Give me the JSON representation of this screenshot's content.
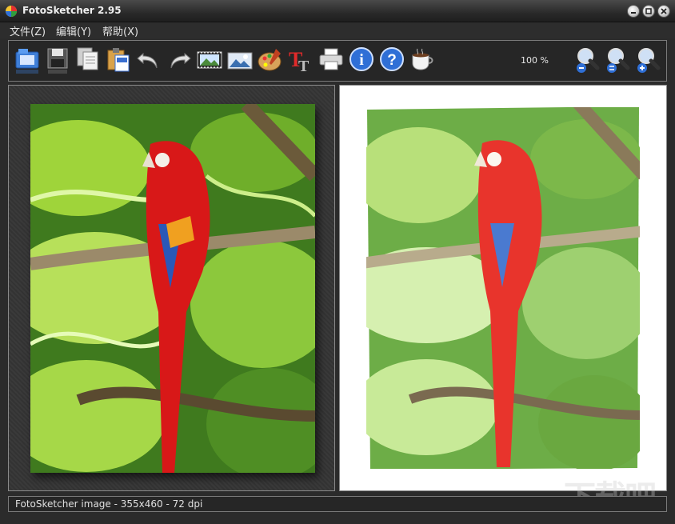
{
  "window": {
    "title": "FotoSketcher 2.95"
  },
  "menu": {
    "file": "文件(Z)",
    "edit": "编辑(Y)",
    "help": "帮助(X)"
  },
  "toolbar": {
    "icons": [
      "open-folder-icon",
      "save-icon",
      "copy-icon",
      "paste-icon",
      "undo-icon",
      "redo-icon",
      "process-image-icon",
      "compare-icon",
      "palette-icon",
      "text-icon",
      "print-icon",
      "info-icon",
      "help-icon",
      "coffee-icon",
      "zoom-out-icon",
      "zoom-fit-icon",
      "zoom-in-icon"
    ],
    "zoom_level": "100 %"
  },
  "status": {
    "text": "FotoSketcher image - 355x460 - 72 dpi"
  },
  "watermark": {
    "text": "下载吧"
  },
  "colors": {
    "background": "#2b2b2b",
    "border": "#7a7a7a",
    "canvas": "#ffffff"
  }
}
